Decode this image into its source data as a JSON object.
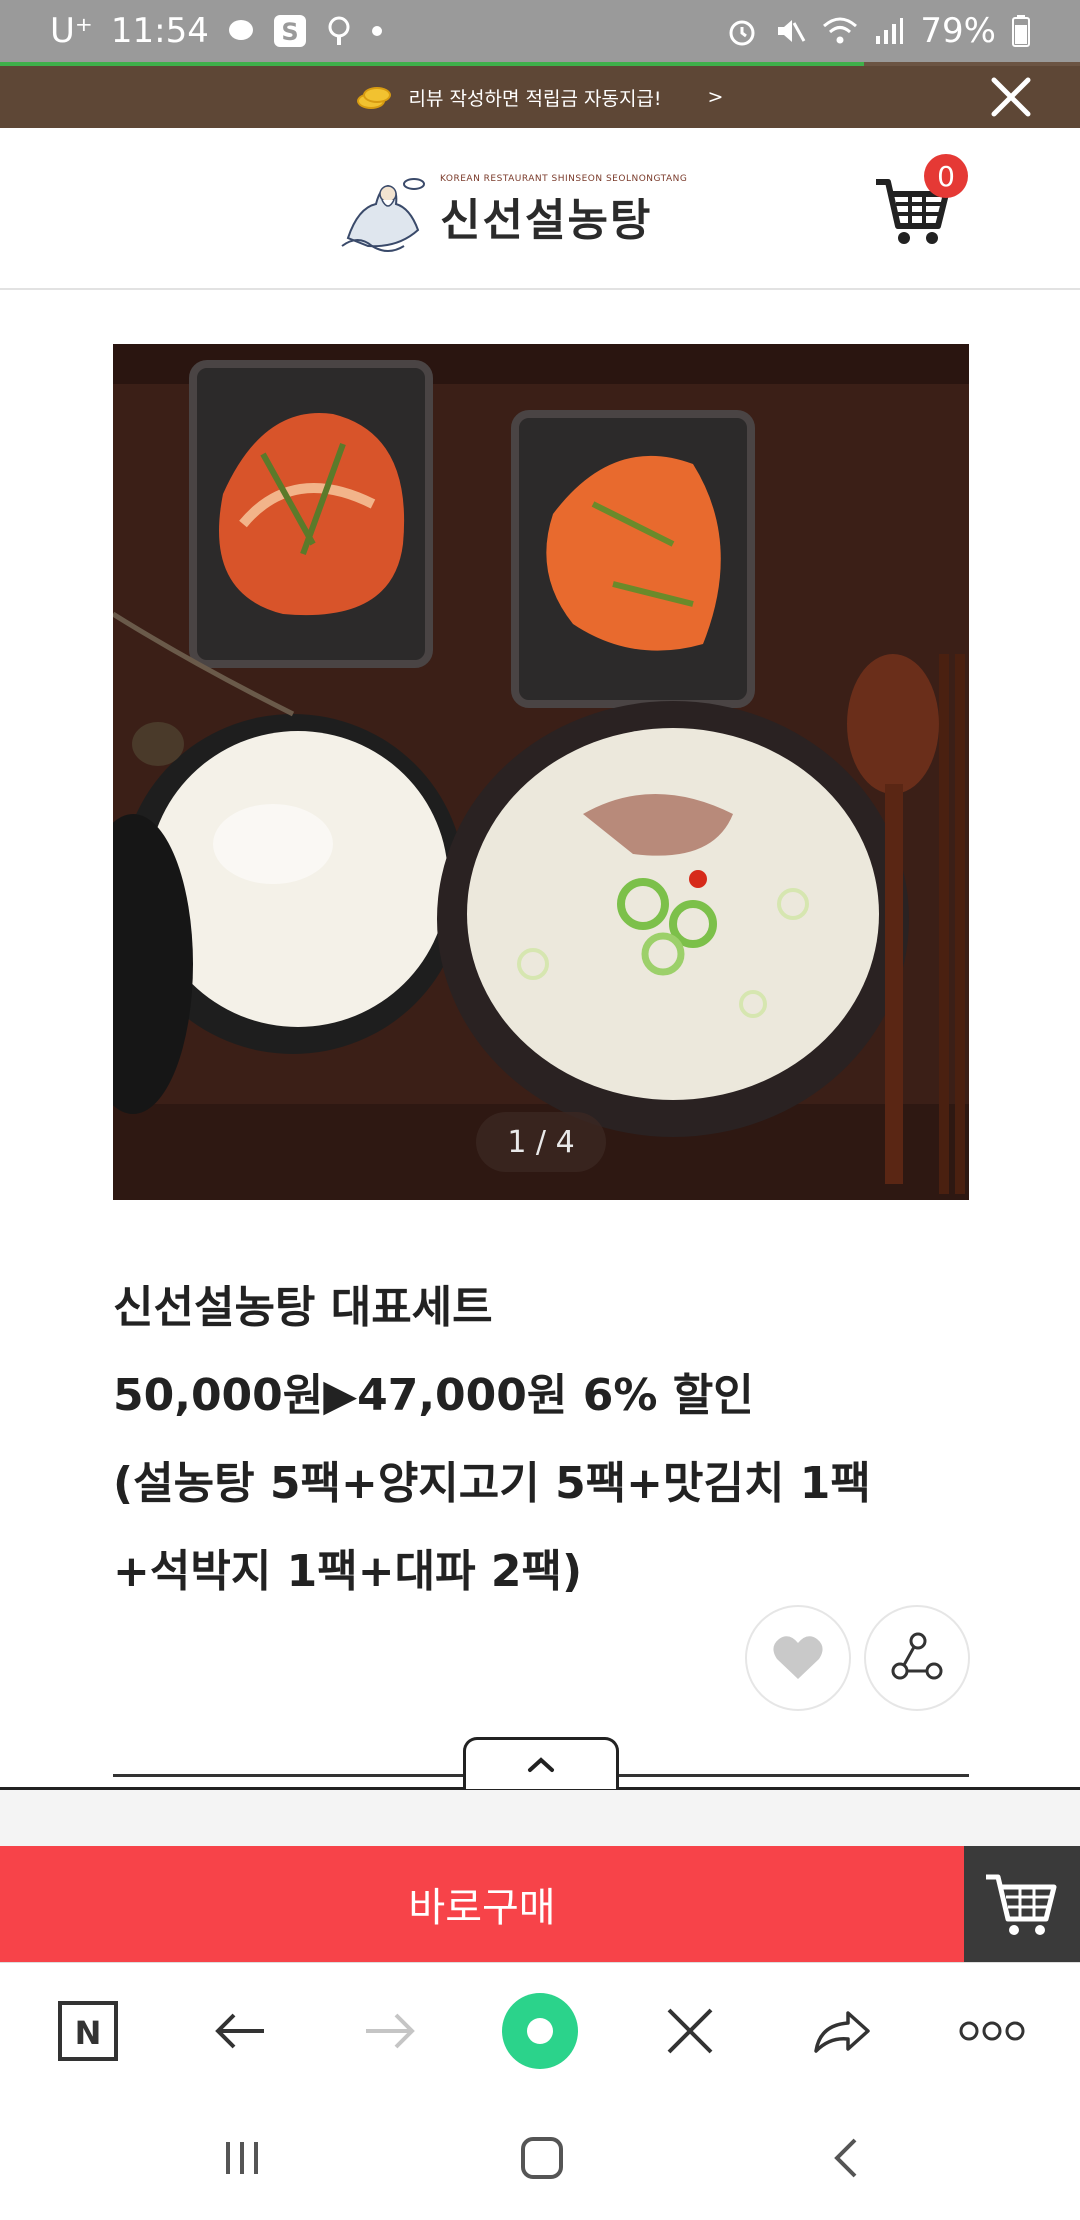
{
  "status_bar": {
    "carrier": "U⁺",
    "time": "11:54",
    "battery": "79%",
    "icons": [
      "chat-bubble-icon",
      "s-app-icon",
      "podcast-icon",
      "dot-icon",
      "alarm-icon",
      "mute-icon",
      "wifi-icon",
      "signal-icon",
      "battery-icon"
    ]
  },
  "page_load_progress": 0.8,
  "promo_banner": {
    "text": "리뷰 작성하면 적립금 자동지급!",
    "arrow": ">"
  },
  "header": {
    "logo_small_text": "KOREAN RESTAURANT SHINSEON SEOLNONGTANG",
    "logo_text": "신선설농탕",
    "cart_count": "0"
  },
  "product": {
    "slide_indicator": "1 / 4",
    "title": "신선설농탕 대표세트",
    "price_line": "50,000원▶47,000원 6% 할인",
    "composition_line_1": "(설농탕 5팩+양지고기 5팩+맛김치 1팩",
    "composition_line_2": "+석박지 1팩+대파 2팩)"
  },
  "buy_bar": {
    "buy_label": "바로구매"
  },
  "colors": {
    "accent_red": "#f74349",
    "promo_brown": "#5e4736",
    "badge_red": "#e53935",
    "progress_green": "#3fb04a",
    "browser_center_green": "#2bd38b"
  },
  "browser_toolbar": {
    "items": [
      "n-logo-icon",
      "back-arrow-icon",
      "forward-arrow-icon",
      "home-circle-icon",
      "close-icon",
      "share-arrow-icon",
      "more-icon"
    ]
  },
  "system_nav": {
    "items": [
      "recents-icon",
      "home-icon",
      "back-icon"
    ]
  }
}
